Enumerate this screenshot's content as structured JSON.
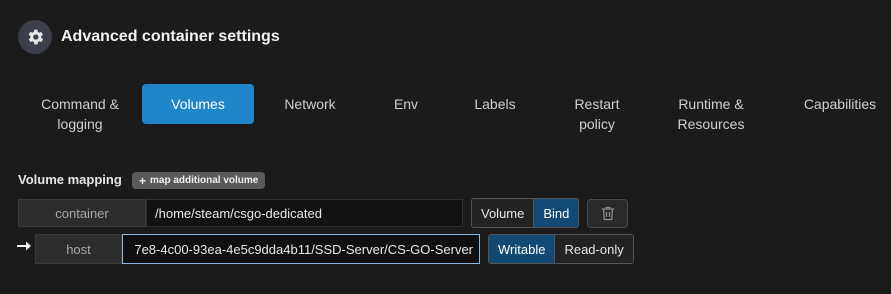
{
  "header": {
    "title": "Advanced container settings",
    "icon": "gear-icon"
  },
  "tabs": [
    {
      "label": "Command & logging"
    },
    {
      "label": "Volumes"
    },
    {
      "label": "Network"
    },
    {
      "label": "Env"
    },
    {
      "label": "Labels"
    },
    {
      "label": "Restart policy"
    },
    {
      "label": "Runtime & Resources"
    },
    {
      "label": "Capabilities"
    }
  ],
  "volumes": {
    "section_label": "Volume mapping",
    "map_additional_label": "map additional volume",
    "container_addon": "container",
    "container_value": "/home/steam/csgo-dedicated",
    "host_addon": "host",
    "host_value": "7e8-4c00-93ea-4e5c9dda4b11/SSD-Server/CS-GO-Server",
    "type_options": [
      "Volume",
      "Bind"
    ],
    "type_selected": "Bind",
    "access_options": [
      "Writable",
      "Read-only"
    ],
    "access_selected": "Writable"
  },
  "colors": {
    "accent": "#1e86c9",
    "selected_segment": "#124a73",
    "background": "#1b1b1b"
  }
}
